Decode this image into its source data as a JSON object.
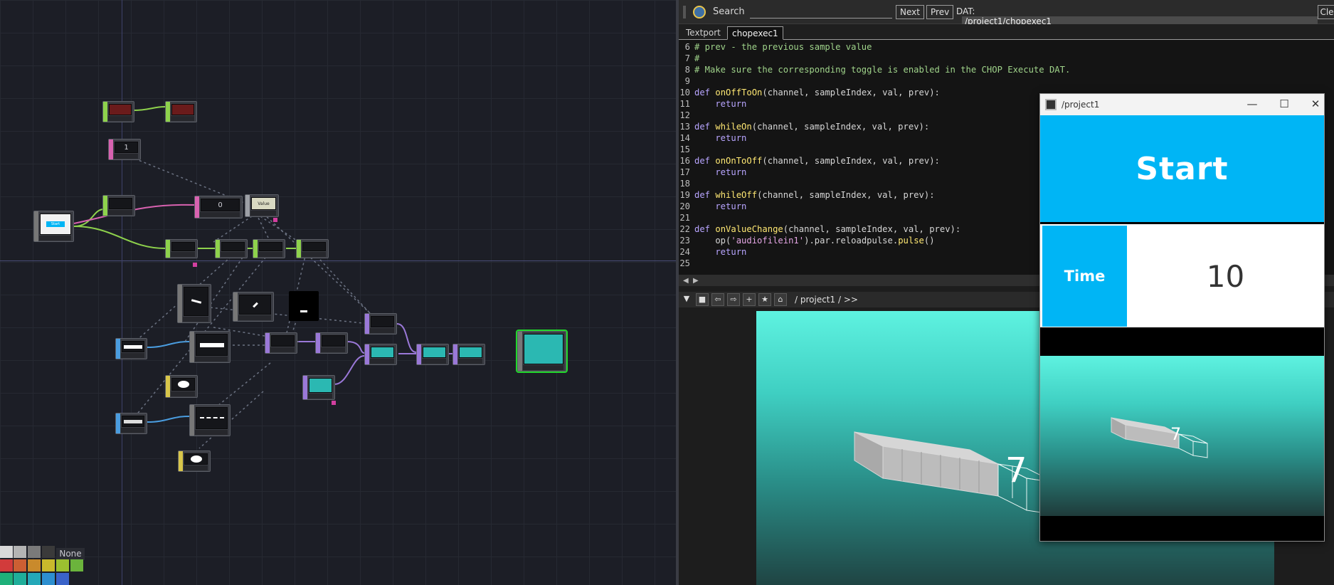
{
  "network": {
    "palette_none_label": "None",
    "nodes": [
      {
        "id": "audiofilein1",
        "thumb": ""
      },
      {
        "id": "audiodeviceout1",
        "thumb": ""
      },
      {
        "id": "constant1",
        "thumb": "1"
      },
      {
        "id": "container1",
        "thumb": "Start"
      },
      {
        "id": "math1",
        "thumb": ""
      },
      {
        "id": "null1",
        "thumb": "0"
      },
      {
        "id": "table1",
        "thumb": "Value"
      }
    ],
    "palette_colors": [
      "#d9d9d9",
      "#b4b4b4",
      "#7a7a7a",
      "#3a3a3a",
      "#d23b3b",
      "#cc5f33",
      "#c98a2c",
      "#c9b92c",
      "#9cc030",
      "#6bb43c",
      "#1fb07a",
      "#1fae9a",
      "#24a8b8",
      "#2d8fcf",
      "#3a63c9"
    ]
  },
  "textport": {
    "search_label": "Search",
    "search_value": "",
    "next_label": "Next",
    "prev_label": "Prev",
    "dat_label": "DAT:",
    "dat_path": "/project1/chopexec1",
    "clear_label": "Cle",
    "tabs": [
      "Textport",
      "chopexec1"
    ],
    "active_tab": "chopexec1",
    "lines": [
      {
        "n": "6",
        "parts": [
          {
            "c": "cm",
            "t": "# prev - the previous sample value"
          }
        ]
      },
      {
        "n": "7",
        "parts": [
          {
            "c": "cm",
            "t": "#"
          }
        ]
      },
      {
        "n": "8",
        "parts": [
          {
            "c": "cm",
            "t": "# Make sure the corresponding toggle is enabled in the CHOP Execute DAT."
          }
        ]
      },
      {
        "n": "9",
        "parts": []
      },
      {
        "n": "10",
        "parts": [
          {
            "c": "kw",
            "t": "def "
          },
          {
            "c": "fn",
            "t": "onOffToOn"
          },
          {
            "c": "tx",
            "t": "(channel, sampleIndex, val, prev):"
          }
        ]
      },
      {
        "n": "11",
        "parts": [
          {
            "c": "kw",
            "t": "    return"
          }
        ]
      },
      {
        "n": "12",
        "parts": []
      },
      {
        "n": "13",
        "parts": [
          {
            "c": "kw",
            "t": "def "
          },
          {
            "c": "fn",
            "t": "whileOn"
          },
          {
            "c": "tx",
            "t": "(channel, sampleIndex, val, prev):"
          }
        ]
      },
      {
        "n": "14",
        "parts": [
          {
            "c": "kw",
            "t": "    return"
          }
        ]
      },
      {
        "n": "15",
        "parts": []
      },
      {
        "n": "16",
        "parts": [
          {
            "c": "kw",
            "t": "def "
          },
          {
            "c": "fn",
            "t": "onOnToOff"
          },
          {
            "c": "tx",
            "t": "(channel, sampleIndex, val, prev):"
          }
        ]
      },
      {
        "n": "17",
        "parts": [
          {
            "c": "kw",
            "t": "    return"
          }
        ]
      },
      {
        "n": "18",
        "parts": []
      },
      {
        "n": "19",
        "parts": [
          {
            "c": "kw",
            "t": "def "
          },
          {
            "c": "fn",
            "t": "whileOff"
          },
          {
            "c": "tx",
            "t": "(channel, sampleIndex, val, prev):"
          }
        ]
      },
      {
        "n": "20",
        "parts": [
          {
            "c": "kw",
            "t": "    return"
          }
        ]
      },
      {
        "n": "21",
        "parts": []
      },
      {
        "n": "22",
        "parts": [
          {
            "c": "kw",
            "t": "def "
          },
          {
            "c": "fn",
            "t": "onValueChange"
          },
          {
            "c": "tx",
            "t": "(channel, sampleIndex, val, prev):"
          }
        ]
      },
      {
        "n": "23",
        "parts": [
          {
            "c": "tx",
            "t": "    op("
          },
          {
            "c": "st",
            "t": "'audiofilein1'"
          },
          {
            "c": "tx",
            "t": ").par.reloadpulse."
          },
          {
            "c": "fn",
            "t": "pulse"
          },
          {
            "c": "tx",
            "t": "()"
          }
        ]
      },
      {
        "n": "24",
        "parts": [
          {
            "c": "kw",
            "t": "    return"
          }
        ]
      },
      {
        "n": "25",
        "parts": []
      }
    ]
  },
  "viewer": {
    "path": "/ project1 / >>",
    "render_digit": "7"
  },
  "floating_window": {
    "title": "/project1",
    "start_label": "Start",
    "time_label": "Time",
    "time_value": "10",
    "render_digit": "7"
  }
}
